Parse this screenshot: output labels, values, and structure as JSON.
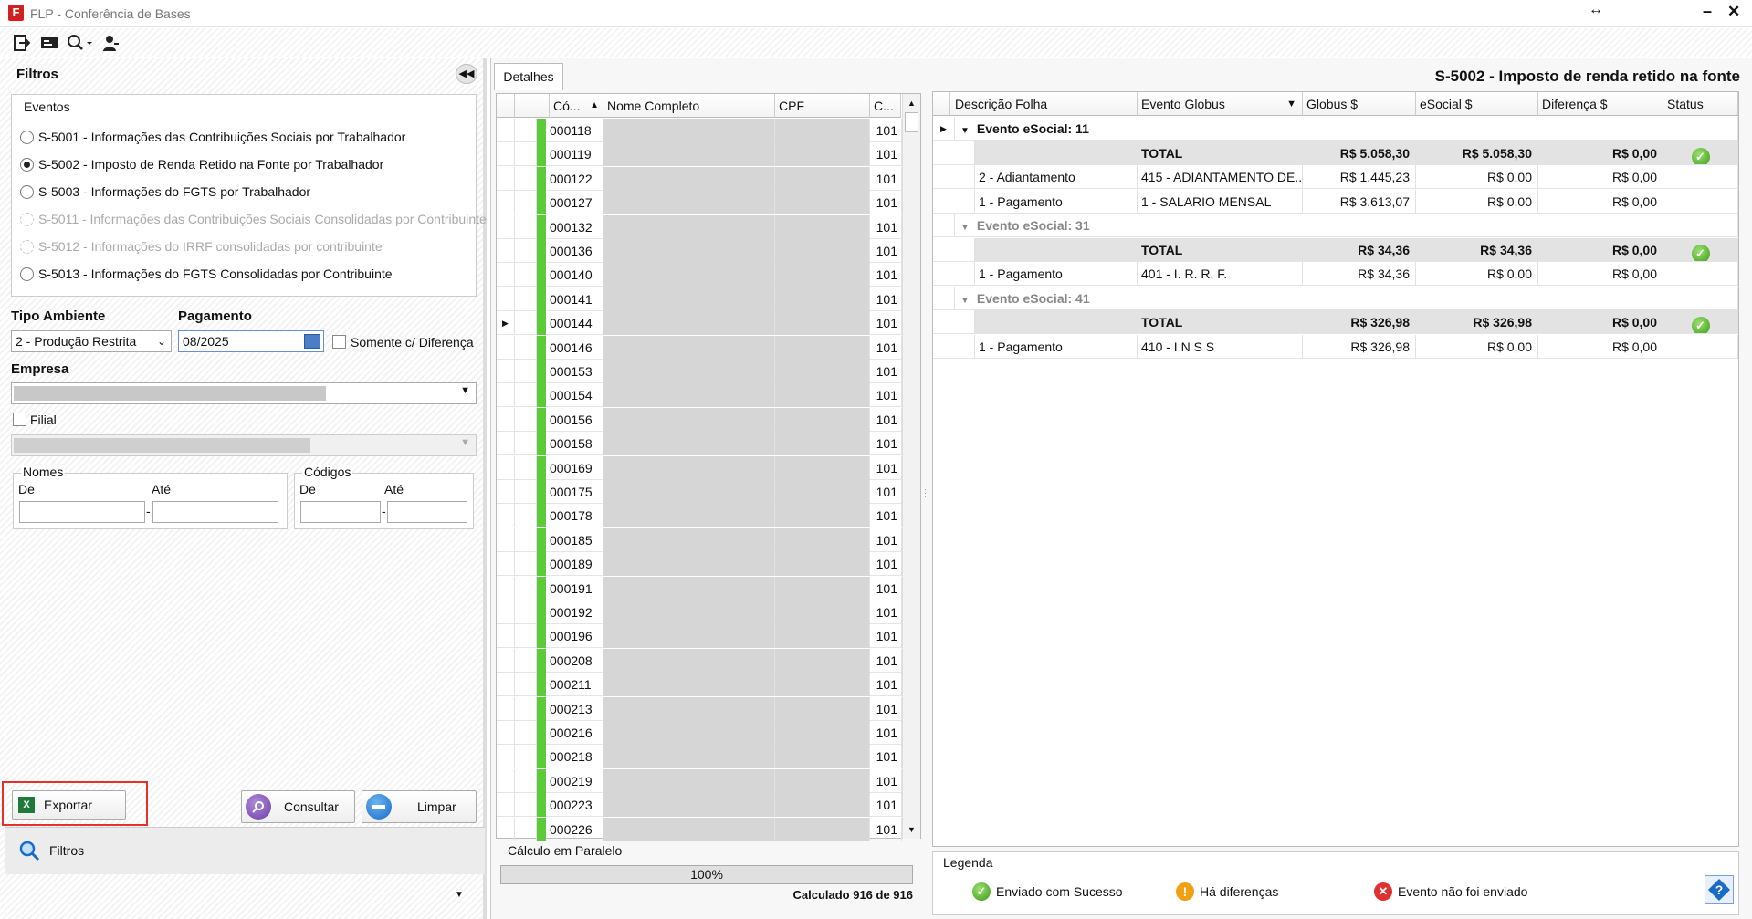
{
  "window": {
    "title": "FLP - Conferência de Bases",
    "app_logo": "F"
  },
  "toolbar": {
    "icons": [
      "exit-icon",
      "card-icon",
      "search-dropdown-icon",
      "user-icon"
    ]
  },
  "filters": {
    "title": "Filtros",
    "events_label": "Eventos",
    "events": [
      {
        "label": "S-5001 - Informações das Contribuições Sociais por Trabalhador",
        "selected": false,
        "disabled": false
      },
      {
        "label": "S-5002 - Imposto de Renda Retido na Fonte por Trabalhador",
        "selected": true,
        "disabled": false
      },
      {
        "label": "S-5003 - Informações do FGTS por Trabalhador",
        "selected": false,
        "disabled": false
      },
      {
        "label": "S-5011 - Informações das Contribuições Sociais Consolidadas por Contribuinte",
        "selected": false,
        "disabled": true
      },
      {
        "label": "S-5012 - Informações do IRRF consolidadas por contribuinte",
        "selected": false,
        "disabled": true
      },
      {
        "label": "S-5013 - Informações do FGTS Consolidadas por Contribuinte",
        "selected": false,
        "disabled": false
      }
    ],
    "tipo_ambiente_label": "Tipo Ambiente",
    "tipo_ambiente_value": "2 - Produção Restrita",
    "pagamento_label": "Pagamento",
    "pagamento_value": "08/2025",
    "somente_diferenca_label": "Somente c/ Diferença",
    "empresa_label": "Empresa",
    "filial_label": "Filial",
    "nomes_label": "Nomes",
    "codigos_label": "Códigos",
    "de_label": "De",
    "ate_label": "Até",
    "export_button": "Exportar",
    "consultar_button": "Consultar",
    "limpar_button": "Limpar",
    "bottom_tab": "Filtros"
  },
  "details": {
    "tab": "Detalhes",
    "header_title": "S-5002 - Imposto de renda retido na fonte",
    "grid_columns": [
      "Có...",
      "Nome Completo",
      "CPF",
      "C..."
    ],
    "rows": [
      "000118",
      "000119",
      "000122",
      "000127",
      "000132",
      "000136",
      "000140",
      "000141",
      "000144",
      "000146",
      "000153",
      "000154",
      "000156",
      "000158",
      "000169",
      "000175",
      "000178",
      "000185",
      "000189",
      "000191",
      "000192",
      "000196",
      "000208",
      "000211",
      "000213",
      "000216",
      "000218",
      "000219",
      "000223",
      "000226"
    ],
    "row_col": "101",
    "calc_label": "Cálculo em Paralelo",
    "progress_percent": "100%",
    "progress_fraction": 1.0,
    "calc_status": "Calculado 916 de 916"
  },
  "events_grid": {
    "columns": [
      "Descrição Folha",
      "Evento Globus",
      "Globus $",
      "eSocial $",
      "Diferença $",
      "Status"
    ],
    "groups": [
      {
        "title": "Evento eSocial: 11",
        "total": {
          "label": "TOTAL",
          "globus": "R$ 5.058,30",
          "esocial": "R$ 5.058,30",
          "diff": "R$ 0,00"
        },
        "rows": [
          {
            "desc": "2 - Adiantamento",
            "evento": "415 - ADIANTAMENTO DE...",
            "globus": "R$ 1.445,23",
            "esocial": "R$ 0,00",
            "diff": "R$ 0,00"
          },
          {
            "desc": "1 - Pagamento",
            "evento": "1 - SALARIO MENSAL",
            "globus": "R$ 3.613,07",
            "esocial": "R$ 0,00",
            "diff": "R$ 0,00"
          }
        ]
      },
      {
        "title": "Evento eSocial: 31",
        "total": {
          "label": "TOTAL",
          "globus": "R$ 34,36",
          "esocial": "R$ 34,36",
          "diff": "R$ 0,00"
        },
        "rows": [
          {
            "desc": "1 - Pagamento",
            "evento": "401 - I. R. R. F.",
            "globus": "R$ 34,36",
            "esocial": "R$ 0,00",
            "diff": "R$ 0,00"
          }
        ]
      },
      {
        "title": "Evento eSocial: 41",
        "total": {
          "label": "TOTAL",
          "globus": "R$ 326,98",
          "esocial": "R$ 326,98",
          "diff": "R$ 0,00"
        },
        "rows": [
          {
            "desc": "1 - Pagamento",
            "evento": "410 - I N S S",
            "globus": "R$ 326,98",
            "esocial": "R$ 0,00",
            "diff": "R$ 0,00"
          }
        ]
      }
    ]
  },
  "legend": {
    "title": "Legenda",
    "items": [
      "Enviado com Sucesso",
      "Há diferenças",
      "Evento não foi enviado"
    ]
  },
  "colors": {
    "accent_green": "#5ccb3a",
    "highlight": "#e8302a",
    "warning": "#f0a010",
    "error": "#e03030"
  }
}
